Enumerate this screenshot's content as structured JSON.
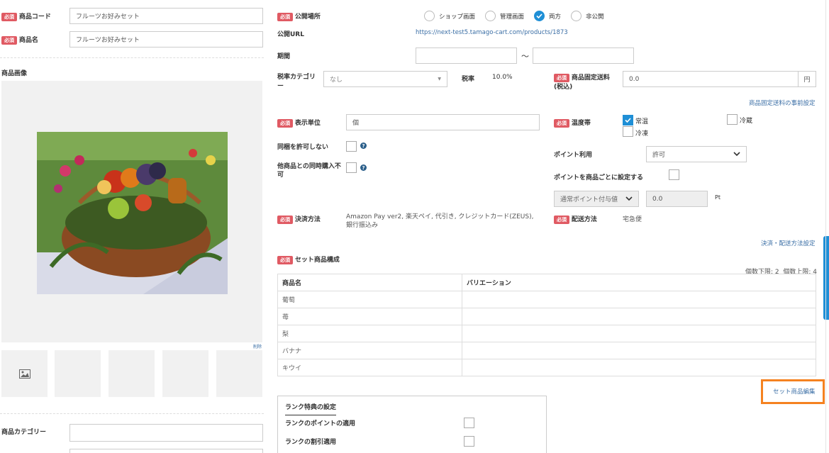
{
  "left": {
    "code": {
      "required": "必須",
      "label": "商品コード",
      "value": "フルーツお好みセット"
    },
    "name": {
      "required": "必須",
      "label": "商品名",
      "value": "フルーツお好みセット"
    },
    "image_label": "商品画像",
    "delete_link": "削除",
    "category_label": "商品カテゴリー"
  },
  "publish": {
    "required": "必須",
    "label": "公開場所",
    "options": [
      "ショップ画面",
      "管理画面",
      "両方",
      "非公開"
    ],
    "selected": 2,
    "url_label": "公開URL",
    "url": "https://next-test5.tamago-cart.com/products/1873"
  },
  "period": {
    "label": "期間",
    "sep": "〜"
  },
  "tax": {
    "category_label": "税率カテゴリー",
    "category_value": "なし",
    "rate_label": "税率",
    "rate_value": "10.0%"
  },
  "shipping_fixed": {
    "required": "必須",
    "label": "商品固定送料(税込)",
    "value": "0.0",
    "unit": "円",
    "link": "商品固定送料の事前設定"
  },
  "unit": {
    "required": "必須",
    "label": "表示単位",
    "value": "個"
  },
  "temperature": {
    "required": "必須",
    "label": "温度帯",
    "options": [
      "常温",
      "冷蔵",
      "冷凍"
    ]
  },
  "no_bundle": {
    "label": "同梱を許可しない"
  },
  "no_simul": {
    "label": "他商品との同時購入不可"
  },
  "points": {
    "use_label": "ポイント利用",
    "use_value": "許可",
    "per_product_label": "ポイントを商品ごとに設定する",
    "type_value": "通常ポイント付与値",
    "value": "0.0",
    "unit": "Pt"
  },
  "payment": {
    "required": "必須",
    "label": "決済方法",
    "value": "Amazon Pay ver2, 楽天ペイ, 代引き, クレジットカード(ZEUS), 銀行振込み"
  },
  "delivery": {
    "required": "必須",
    "label": "配送方法",
    "value": "宅急便",
    "link": "決済・配送方法設定"
  },
  "set": {
    "required": "必須",
    "label": "セット商品構成",
    "limits": "個数下限: 2  個数上限: 4",
    "headers": [
      "商品名",
      "バリエーション"
    ],
    "rows": [
      "葡萄",
      "苺",
      "梨",
      "バナナ",
      "キウイ"
    ],
    "edit_button": "セット商品編集"
  },
  "rank": {
    "title": "ランク特典の設定",
    "points_label": "ランクのポイントの適用",
    "discount_label": "ランクの割引適用"
  },
  "colors": {
    "accent": "#1f8fd6",
    "required": "#e05a63",
    "highlight": "#f58220"
  }
}
